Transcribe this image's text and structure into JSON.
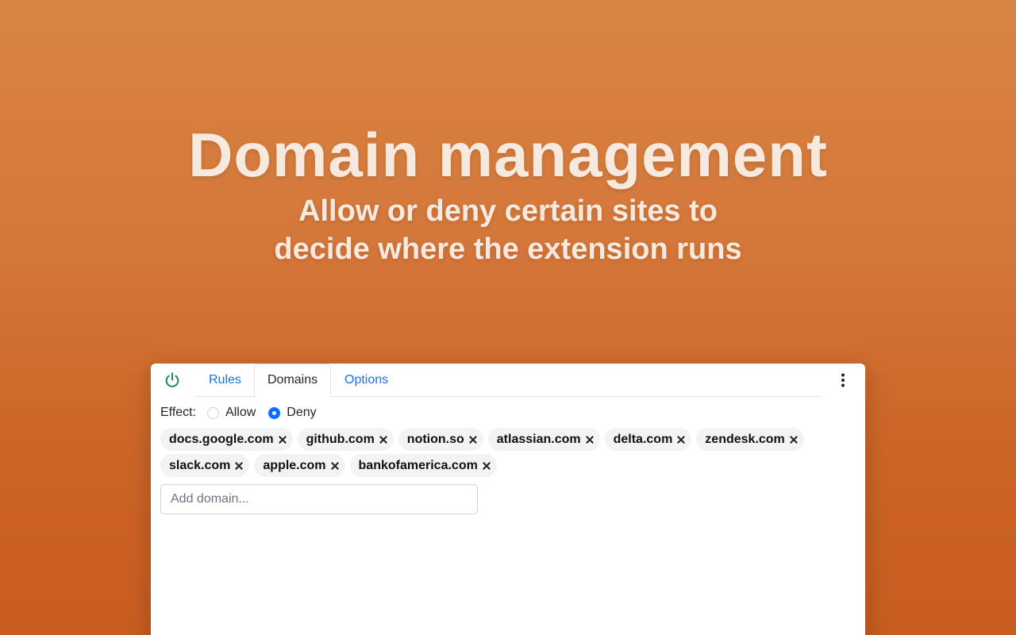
{
  "hero": {
    "title": "Domain management",
    "subtitle_line1": "Allow or deny certain sites to",
    "subtitle_line2": "decide where the extension runs"
  },
  "panel": {
    "tabs": {
      "rules": "Rules",
      "domains": "Domains",
      "options": "Options"
    },
    "active_tab": "Domains",
    "effect": {
      "label": "Effect:",
      "allow_label": "Allow",
      "deny_label": "Deny",
      "selected": "Deny"
    },
    "domains_row1": [
      "docs.google.com",
      "github.com",
      "notion.so",
      "atlassian.com",
      "delta.com",
      "zendesk.com"
    ],
    "domains_row2": [
      "slack.com",
      "apple.com",
      "bankofamerica.com"
    ],
    "add_domain": {
      "placeholder": "Add domain...",
      "value": ""
    }
  },
  "colors": {
    "accent_link": "#1a73e8",
    "power_icon": "#1e8a5a",
    "radio_checked": "#0d6efd",
    "background_top": "#d88543",
    "background_bottom": "#c85d20"
  },
  "icons": {
    "power": "power-icon",
    "menu": "kebab-menu-icon",
    "remove": "close-icon"
  }
}
